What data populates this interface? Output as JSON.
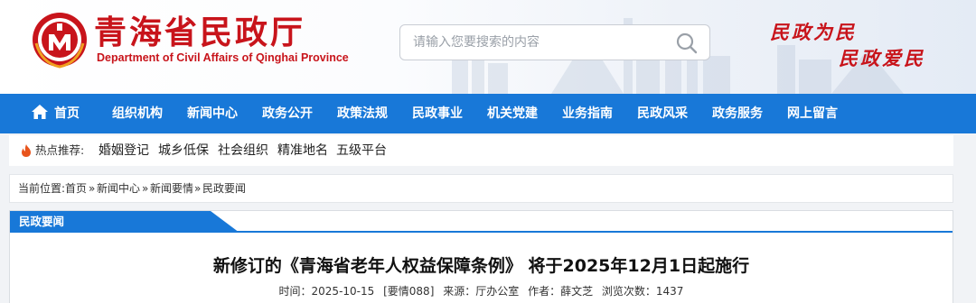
{
  "header": {
    "site_title": "青海省民政厅",
    "site_subtitle": "Department of Civil Affairs of Qinghai Province",
    "search_placeholder": "请输入您要搜索的内容",
    "slogan_line1": "民政为民",
    "slogan_line2": "民政爱民",
    "brand_color": "#c8141b"
  },
  "nav": {
    "color": "#1878d8",
    "items": [
      "首页",
      "组织机构",
      "新闻中心",
      "政务公开",
      "政策法规",
      "民政事业",
      "机关党建",
      "业务指南",
      "民政风采",
      "政务服务",
      "网上留言"
    ]
  },
  "hot": {
    "label": "热点推荐:",
    "icon": "fire-icon",
    "links": [
      "婚姻登记",
      "城乡低保",
      "社会组织",
      "精准地名",
      "五级平台"
    ]
  },
  "breadcrumb": {
    "prefix": "当前位置:",
    "items": [
      "首页",
      "新闻中心",
      "新闻要情",
      "民政要闻"
    ],
    "separator": "»"
  },
  "article": {
    "section_tab": "民政要闻",
    "title": "新修订的《青海省老年人权益保障条例》 将于2025年12月1日起施行",
    "meta": {
      "time": "时间：2025-10-15",
      "tag": "[要情088]",
      "source": "来源：厅办公室",
      "author": "作者：薛文芝",
      "views": "浏览次数：1437"
    }
  }
}
